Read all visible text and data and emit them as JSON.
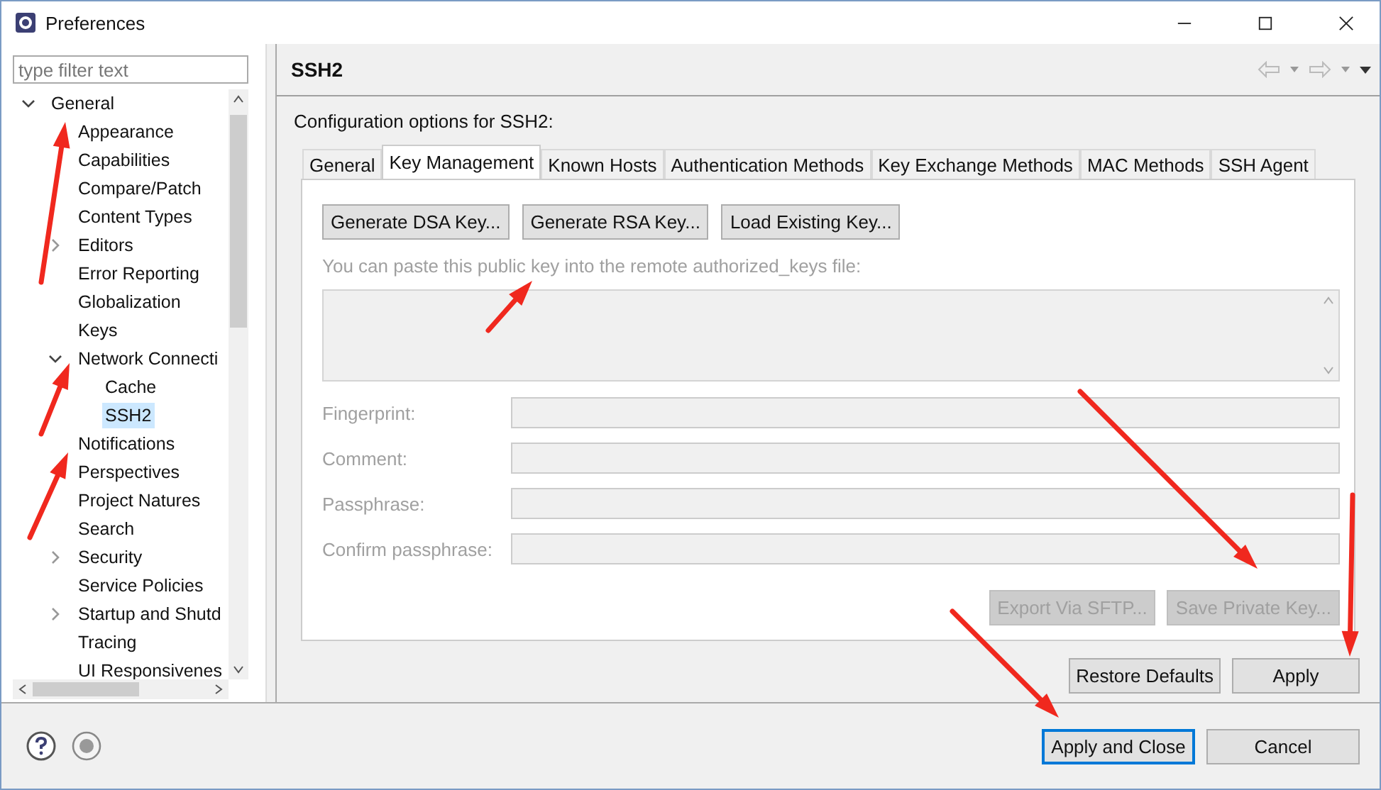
{
  "window": {
    "title": "Preferences"
  },
  "sidebar": {
    "filter": {
      "placeholder": "type filter text"
    },
    "tree": [
      {
        "label": "General",
        "expanded": true,
        "selected": false,
        "children": [
          {
            "label": "Appearance",
            "selected": false
          },
          {
            "label": "Capabilities",
            "selected": false
          },
          {
            "label": "Compare/Patch",
            "selected": false
          },
          {
            "label": "Content Types",
            "selected": false
          },
          {
            "label": "Editors",
            "expanded": false,
            "selected": false
          },
          {
            "label": "Error Reporting",
            "selected": false
          },
          {
            "label": "Globalization",
            "selected": false
          },
          {
            "label": "Keys",
            "selected": false
          },
          {
            "label": "Network Connecti",
            "expanded": true,
            "selected": false,
            "children": [
              {
                "label": "Cache",
                "selected": false
              },
              {
                "label": "SSH2",
                "selected": true
              }
            ]
          },
          {
            "label": "Notifications",
            "selected": false
          },
          {
            "label": "Perspectives",
            "selected": false
          },
          {
            "label": "Project Natures",
            "selected": false
          },
          {
            "label": "Search",
            "selected": false
          },
          {
            "label": "Security",
            "expanded": false,
            "selected": false
          },
          {
            "label": "Service Policies",
            "selected": false
          },
          {
            "label": "Startup and Shutd",
            "expanded": false,
            "selected": false
          },
          {
            "label": "Tracing",
            "selected": false
          },
          {
            "label": "UI Responsivenes",
            "selected": false
          }
        ]
      }
    ]
  },
  "page": {
    "title": "SSH2",
    "description": "Configuration options for SSH2:",
    "tabs": [
      {
        "label": "General",
        "selected": false
      },
      {
        "label": "Key Management",
        "selected": true
      },
      {
        "label": "Known Hosts",
        "selected": false
      },
      {
        "label": "Authentication Methods",
        "selected": false
      },
      {
        "label": "Key Exchange Methods",
        "selected": false
      },
      {
        "label": "MAC Methods",
        "selected": false
      },
      {
        "label": "SSH Agent",
        "selected": false
      }
    ],
    "key_buttons": [
      {
        "label": "Generate DSA Key...",
        "disabled": false
      },
      {
        "label": "Generate RSA Key...",
        "disabled": false
      },
      {
        "label": "Load Existing Key...",
        "disabled": false
      }
    ],
    "hint": "You can paste this public key into the remote authorized_keys file:",
    "fields": [
      {
        "label": "Fingerprint:"
      },
      {
        "label": "Comment:"
      },
      {
        "label": "Passphrase:"
      },
      {
        "label": "Confirm passphrase:"
      }
    ],
    "actions": [
      {
        "label": "Export Via SFTP...",
        "disabled": true
      },
      {
        "label": "Save Private Key...",
        "disabled": true
      }
    ],
    "page_buttons": [
      {
        "label": "Restore Defaults"
      },
      {
        "label": "Apply"
      }
    ]
  },
  "footer": {
    "buttons": [
      {
        "label": "Apply and Close",
        "default": true
      },
      {
        "label": "Cancel",
        "default": false
      }
    ]
  }
}
